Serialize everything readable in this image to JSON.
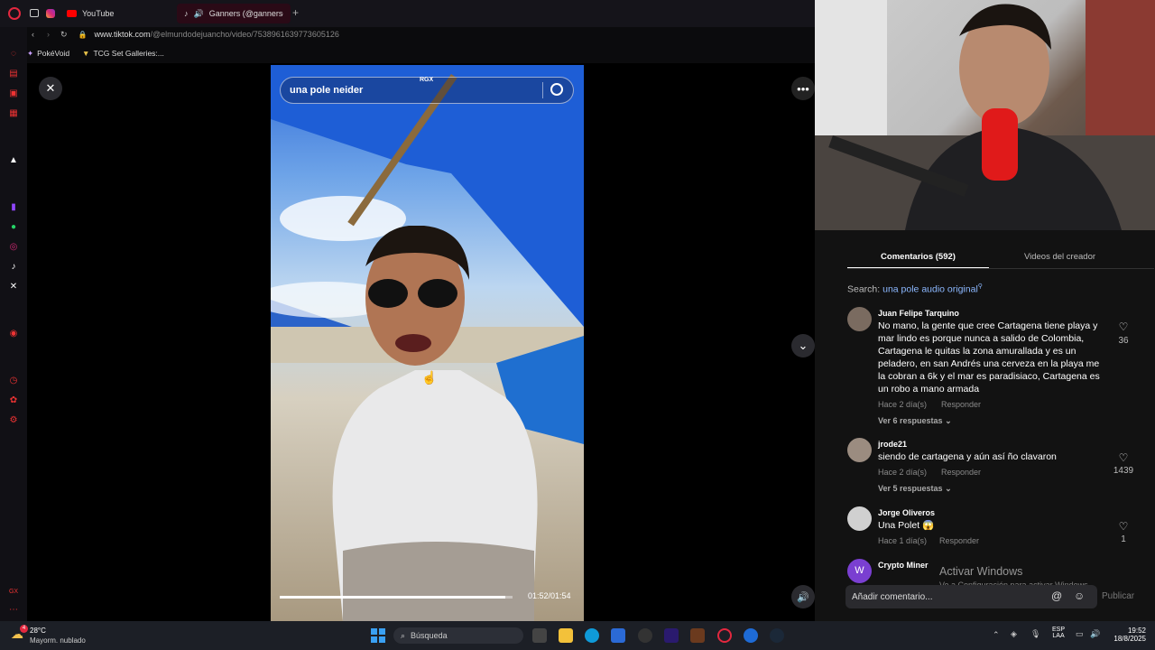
{
  "browser": {
    "tabs": [
      {
        "label": "YouTube",
        "icon": "youtube-icon"
      },
      {
        "label": "Ganners (@gannersof",
        "icon": "tiktok-icon",
        "active": true
      }
    ],
    "url_host": "www.tiktok.com",
    "url_path": "/@elmundodejuancho/video/7538961639773605126",
    "bookmarks": [
      "PokéVoid",
      "TCG Set Galleries:..."
    ]
  },
  "video": {
    "search_text": "una pole neider",
    "badge": "RGX",
    "time": "01:52/01:54",
    "progress_fraction": 0.97
  },
  "panel": {
    "tab_comments": "Comentarios (592)",
    "tab_creator": "Videos del creador",
    "search_prefix": "Search:",
    "search_link": "una pole audio original",
    "comments": [
      {
        "user": "Juan Felipe Tarquino",
        "text": "No mano, la gente que cree Cartagena tiene playa y mar lindo es porque nunca a salido de Colombia, Cartagena le quitas la zona amurallada y es un peladero, en san Andrés una cerveza en la playa me la cobran a 6k y el mar es paradisiaco, Cartagena es un robo a mano armada",
        "time": "Hace 2 día(s)",
        "reply": "Responder",
        "replies": "Ver 6 respuestas",
        "likes": "36"
      },
      {
        "user": "jrode21",
        "text": "siendo de cartagena y aún así ño clavaron",
        "time": "Hace 2 día(s)",
        "reply": "Responder",
        "replies": "Ver 5 respuestas",
        "likes": "1439"
      },
      {
        "user": "Jorge Oliveros",
        "text": "Una Polet 😱",
        "time": "Hace 1 día(s)",
        "reply": "Responder",
        "likes": "1"
      },
      {
        "user": "Crypto Miner",
        "avatar_letter": "W"
      }
    ],
    "watermark_title": "Activar Windows",
    "watermark_sub": "Ve a Configuración para activar Windows.",
    "comment_placeholder": "Añadir comentario...",
    "publish": "Publicar"
  },
  "taskbar": {
    "weather_temp": "28°C",
    "weather_desc": "Mayorm. nublado",
    "weather_badge": "4",
    "search": "Búsqueda",
    "lang1": "ESP",
    "lang2": "LAA",
    "clock_time": "19:52",
    "clock_date": "18/8/2025"
  },
  "colors": {
    "tiktok_link": "#8cb8ff",
    "opera_red": "#e3283f"
  }
}
